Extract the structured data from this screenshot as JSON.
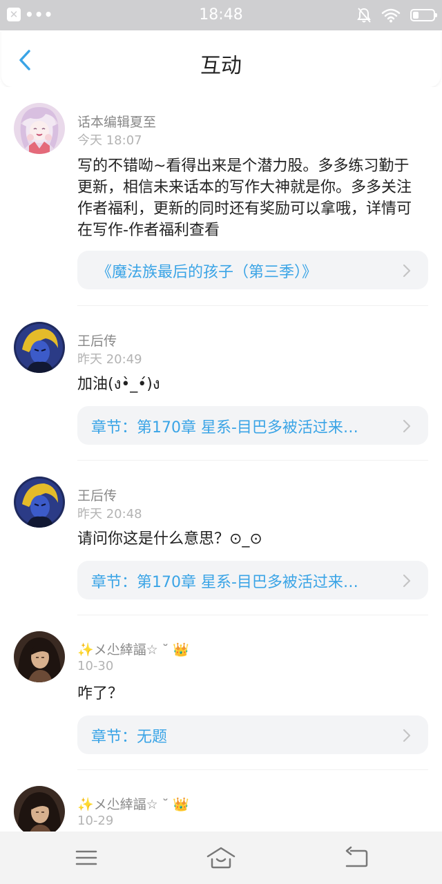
{
  "status_bar": {
    "time": "18:48",
    "notification_icon": "close-box-icon",
    "more_dots": "•••",
    "icons": [
      "silent-bell-icon",
      "wifi-icon",
      "battery-icon"
    ],
    "battery_level": 0.3
  },
  "header": {
    "title": "互动",
    "back_icon": "chevron-left-icon"
  },
  "items": [
    {
      "username": "话本编辑夏至",
      "time": "今天 18:07",
      "content": "写的不错呦~看得出来是个潜力股。多多练习勤于更新，相信未来话本的写作大神就是你。多多关注作者福利，更新的同时还有奖励可以拿哦，详情可在写作-作者福利查看",
      "link": "《魔法族最后的孩子（第三季）》"
    },
    {
      "username": "王后传",
      "time": "昨天 20:49",
      "content": "加油(ง•̀_•́)ง",
      "link": "章节：第170章 星系-目巴多被活过来…"
    },
    {
      "username": "王后传",
      "time": "昨天 20:48",
      "content": "请问你这是什么意思？⊙_⊙",
      "link": "章节：第170章 星系-目巴多被活过来…"
    },
    {
      "username": "✨メ尐緈諨☆ ˘",
      "crown": "👑",
      "time": "10-30",
      "content": "咋了？",
      "link": "章节：无题"
    },
    {
      "username": "✨メ尐緈諨☆ ˘",
      "crown": "👑",
      "time": "10-29"
    }
  ],
  "nav_bar": {
    "icons": [
      "menu-icon",
      "home-icon",
      "back-icon"
    ]
  },
  "colors": {
    "status_bar_bg": "#cfcfd1",
    "accent_blue": "#3aa4e6",
    "chip_bg": "#f3f4f6",
    "nav_bg": "#f3f3f3",
    "crown": "#f5b800"
  }
}
